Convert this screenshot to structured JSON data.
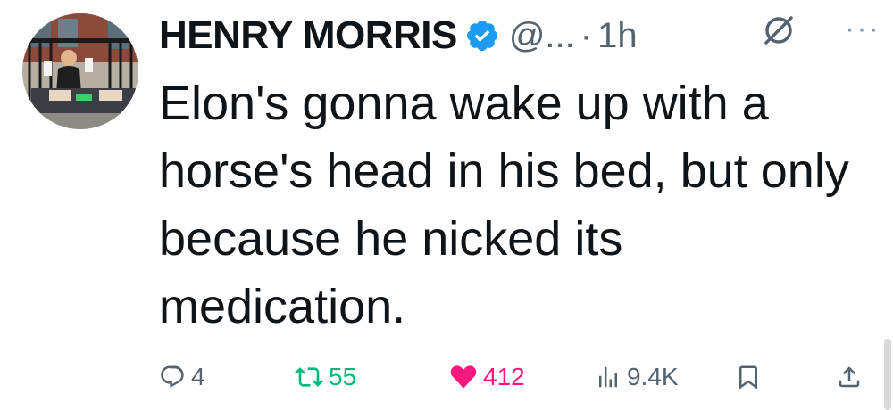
{
  "tweet": {
    "author_name": "HENRY MORRIS",
    "handle": "@...",
    "separator": "·",
    "time": "1h",
    "text": "Elon's gonna wake up with a horse's head in his bed, but only because he nicked its medication.",
    "more_label": "···"
  },
  "actions": {
    "replies": "4",
    "reposts": "55",
    "likes": "412",
    "views": "9.4K"
  },
  "icons": {
    "verified": "verified-badge-icon",
    "grok": "grok-icon",
    "more": "more-icon",
    "reply": "reply-icon",
    "repost": "repost-icon",
    "like": "heart-icon",
    "views": "views-icon",
    "bookmark": "bookmark-icon",
    "share": "share-icon"
  },
  "colors": {
    "verified": "#1d9bf0",
    "repost_active": "#00ba7c",
    "like_active": "#f91880",
    "secondary_text": "#536471"
  }
}
